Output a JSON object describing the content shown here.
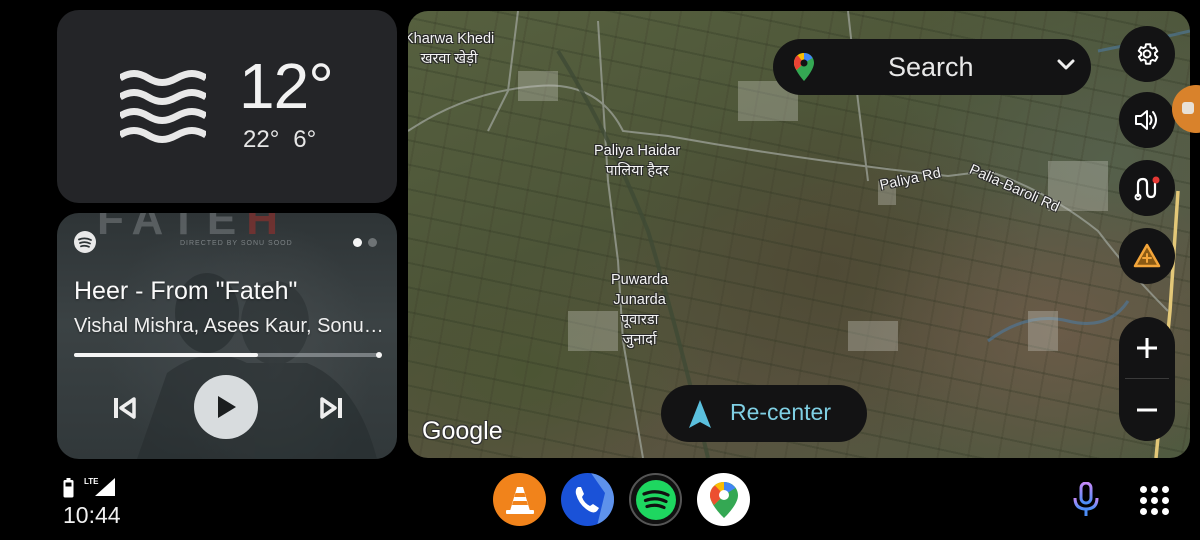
{
  "weather": {
    "icon": "fog-icon",
    "current_temp": "12°",
    "high": "22°",
    "low": "6°"
  },
  "media": {
    "source_app": "Spotify",
    "album_art_text": {
      "main": "FATE",
      "accent": "H",
      "credit": "DIRECTED BY SONU SOOD"
    },
    "page_indicator": {
      "count": 2,
      "active": 0
    },
    "track_title": "Heer - From \"Fateh\"",
    "artist": "Vishal Mishra, Asees Kaur, Sonu Sood",
    "progress_fraction": 0.6,
    "controls": {
      "previous": "skip-previous-icon",
      "play": "play-icon",
      "next": "skip-next-icon"
    }
  },
  "status_bar": {
    "battery_icon": "battery-icon",
    "network_label": "LTE",
    "signal_icon": "signal-icon",
    "time": "10:44"
  },
  "dock": {
    "apps": [
      {
        "name": "VLC",
        "icon": "vlc-icon",
        "color": "#f1831b"
      },
      {
        "name": "Phone",
        "icon": "phone-icon",
        "color": "#1a52d8"
      },
      {
        "name": "Spotify",
        "icon": "spotify-icon",
        "color": "#1ed760"
      },
      {
        "name": "Google Maps",
        "icon": "google-maps-icon",
        "color": "#ffffff"
      }
    ],
    "assistant_icon": "microphone-icon",
    "launcher_icon": "app-grid-icon"
  },
  "map": {
    "search_placeholder": "Search",
    "attribution": "Google",
    "recenter_label": "Re-center",
    "accent_color": "#7fcfe3",
    "labels": [
      {
        "id": "kharwa-khedi",
        "lines": [
          "Kharwa Khedi",
          "खरवा खेड़ी"
        ]
      },
      {
        "id": "paliya-haidar",
        "lines": [
          "Paliya Haidar",
          "पालिया हैदर"
        ]
      },
      {
        "id": "puwarda-junarda",
        "lines": [
          "Puwarda",
          "Junarda",
          "पूवारडा",
          "जुनार्दा"
        ]
      },
      {
        "id": "paliya-rd",
        "lines": [
          "Paliya Rd"
        ]
      },
      {
        "id": "palia-baroli-rd",
        "lines": [
          "Palia-Baroli Rd"
        ]
      }
    ],
    "buttons": {
      "settings": "settings-icon",
      "sound": "volume-icon",
      "route": "route-options-icon",
      "report": "report-incident-icon",
      "zoom_in": "+",
      "zoom_out": "−"
    }
  },
  "overlay": {
    "screen_recorder": "screen-recorder-bubble"
  }
}
